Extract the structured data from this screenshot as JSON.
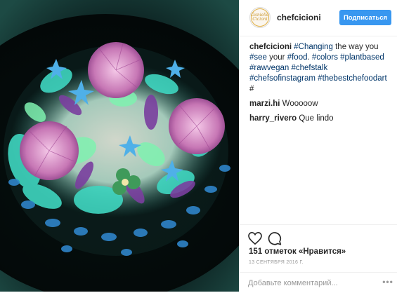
{
  "post": {
    "author": {
      "username": "chefcicioni",
      "avatar_text": "Danielle Cicioni",
      "follow_label": "Подписаться"
    },
    "caption": {
      "username": "chefcicioni",
      "parts": [
        {
          "text": "#Changing",
          "tag": true
        },
        {
          "text": " the way you ",
          "tag": false
        },
        {
          "text": "#see",
          "tag": true
        },
        {
          "text": " your ",
          "tag": false
        },
        {
          "text": "#food",
          "tag": true
        },
        {
          "text": ". ",
          "tag": false
        },
        {
          "text": "#colors",
          "tag": true
        },
        {
          "text": " ",
          "tag": false
        },
        {
          "text": "#plantbased",
          "tag": true
        },
        {
          "text": " ",
          "tag": false
        },
        {
          "text": "#rawvegan",
          "tag": true
        },
        {
          "text": " ",
          "tag": false
        },
        {
          "text": "#chefstalk",
          "tag": true
        },
        {
          "text": " ",
          "tag": false
        },
        {
          "text": "#chefsofinstagram",
          "tag": true
        },
        {
          "text": " ",
          "tag": false
        },
        {
          "text": "#thebestchefoodart",
          "tag": true
        },
        {
          "text": " #",
          "tag": false
        }
      ]
    },
    "comments": [
      {
        "username": "marzi.hi",
        "text": "Wooooow"
      },
      {
        "username": "harry_rivero",
        "text": "Que lindo"
      }
    ],
    "icons": {
      "like": "heart-icon",
      "comment": "comment-bubble-icon",
      "more": "more-dots-icon"
    },
    "likes_text": "151 отметок «Нравится»",
    "date_text": "13 СЕНТЯБРЯ 2016 Г.",
    "add_comment_placeholder": "Добавьте комментарий...",
    "more_label": "•••",
    "colors": {
      "follow_button": "#3897f0",
      "hashtag": "#003569",
      "date": "#999999"
    }
  }
}
